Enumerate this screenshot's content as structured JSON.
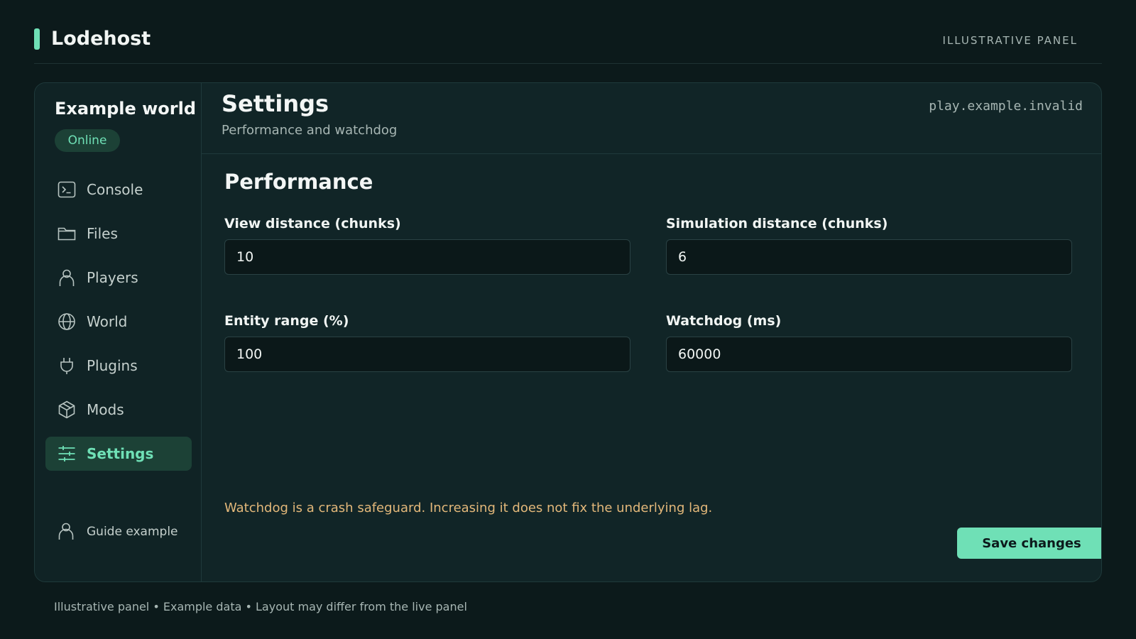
{
  "app": {
    "brand": "Lodehost",
    "panel_tag": "ILLUSTRATIVE PANEL"
  },
  "sidebar": {
    "server_name": "Example world",
    "status": "Online",
    "items": [
      {
        "label": "Console",
        "icon": "terminal-icon",
        "active": false
      },
      {
        "label": "Files",
        "icon": "folder-icon",
        "active": false
      },
      {
        "label": "Players",
        "icon": "user-icon",
        "active": false
      },
      {
        "label": "World",
        "icon": "globe-icon",
        "active": false
      },
      {
        "label": "Plugins",
        "icon": "plug-icon",
        "active": false
      },
      {
        "label": "Mods",
        "icon": "cube-icon",
        "active": false
      },
      {
        "label": "Settings",
        "icon": "sliders-icon",
        "active": true
      }
    ],
    "user": "Guide example"
  },
  "header": {
    "title": "Settings",
    "subtitle": "Performance and watchdog",
    "address": "play.example.invalid"
  },
  "section": {
    "title": "Performance",
    "fields": [
      {
        "label": "View distance (chunks)",
        "value": "10"
      },
      {
        "label": "Simulation distance (chunks)",
        "value": "6"
      },
      {
        "label": "Entity range (%)",
        "value": "100"
      },
      {
        "label": "Watchdog (ms)",
        "value": "60000"
      }
    ]
  },
  "warning": "Watchdog is a crash safeguard. Increasing it does not fix the underlying lag.",
  "save_label": "Save changes",
  "footer": "Illustrative panel • Example data • Layout may differ from the live panel",
  "colors": {
    "accent": "#6fe0b6",
    "warning": "#e3b87a",
    "background": "#0c1a1b",
    "card": "#112527"
  }
}
